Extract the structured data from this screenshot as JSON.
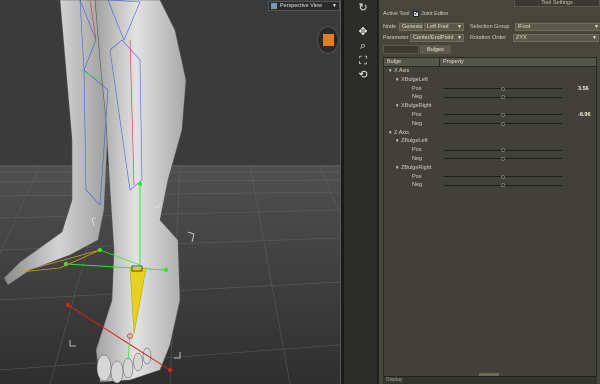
{
  "viewport": {
    "view_label": "Perspective View"
  },
  "panel": {
    "tab_title": "Tool Settings",
    "active_tool": {
      "label": "Active Tool",
      "checkbox": "✔",
      "value": "Joint Editor"
    },
    "node": {
      "label": "Node",
      "figure": "Genesis",
      "node": "Left Foot"
    },
    "selection_group": {
      "label": "Selection Group",
      "value": "lFoot"
    },
    "parameter": {
      "label": "Parameter",
      "value": "Center/EndPoint"
    },
    "rotation_order": {
      "label": "Rotation Order",
      "value": "ZYX"
    },
    "tabs": [
      "",
      "Bulges"
    ],
    "columns": [
      "Bulge",
      "Property"
    ],
    "rows": [
      {
        "name": "X Axis",
        "level": 0,
        "type": "group"
      },
      {
        "name": "XBulgeLeft",
        "level": 1,
        "type": "group"
      },
      {
        "name": "Pos",
        "level": 2,
        "type": "param",
        "value": "3.56",
        "fraction": 0.5,
        "dim": false
      },
      {
        "name": "Neg",
        "level": 2,
        "type": "param",
        "value": "",
        "fraction": 0.5,
        "dim": true
      },
      {
        "name": "XBulgeRight",
        "level": 1,
        "type": "group"
      },
      {
        "name": "Pos",
        "level": 2,
        "type": "param",
        "value": "-8.96",
        "fraction": 0.5,
        "dim": false
      },
      {
        "name": "Neg",
        "level": 2,
        "type": "param",
        "value": "",
        "fraction": 0.5,
        "dim": true
      },
      {
        "name": "Z Axis",
        "level": 0,
        "type": "group"
      },
      {
        "name": "ZBulgeLeft",
        "level": 1,
        "type": "group"
      },
      {
        "name": "Pos",
        "level": 2,
        "type": "param",
        "value": "",
        "fraction": 0.5,
        "dim": true
      },
      {
        "name": "Neg",
        "level": 2,
        "type": "param",
        "value": "",
        "fraction": 0.5,
        "dim": true
      },
      {
        "name": "ZBulgeRight",
        "level": 1,
        "type": "group"
      },
      {
        "name": "Pos",
        "level": 2,
        "type": "param",
        "value": "",
        "fraction": 0.5,
        "dim": true
      },
      {
        "name": "Neg",
        "level": 2,
        "type": "param",
        "value": "",
        "fraction": 0.5,
        "dim": true
      }
    ],
    "bottom_label": "Display"
  },
  "toolbar": {
    "icons": [
      "rotate-camera-icon",
      "pan-camera-icon",
      "zoom-camera-icon",
      "frame-icon",
      "reset-view-icon"
    ]
  },
  "colors": {
    "panel_bg": "#46463c",
    "viewport_bg": "#3d3d3d",
    "bone_yellow": "#e6d21e",
    "bone_green": "#2ee82e",
    "bone_red": "#e01e1e",
    "cam_orange": "#e0801e"
  }
}
